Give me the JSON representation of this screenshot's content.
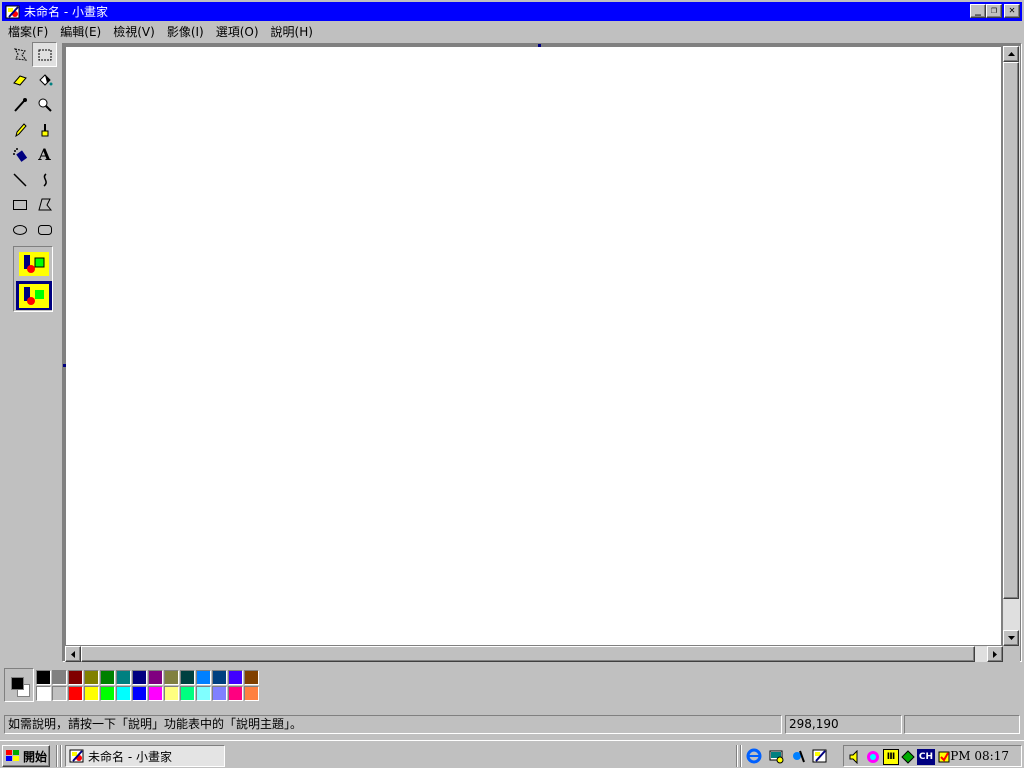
{
  "window": {
    "title": "未命名 - 小畫家",
    "minimize_glyph": "_",
    "restore_glyph": "❐",
    "close_glyph": "✕"
  },
  "menu": {
    "items": [
      {
        "label": "檔案(F)"
      },
      {
        "label": "編輯(E)"
      },
      {
        "label": "檢視(V)"
      },
      {
        "label": "影像(I)"
      },
      {
        "label": "選項(O)"
      },
      {
        "label": "說明(H)"
      }
    ]
  },
  "toolbox": {
    "tools": [
      {
        "icon": "free-form-select-icon"
      },
      {
        "icon": "rect-select-icon",
        "pressed": true
      },
      {
        "icon": "eraser-icon"
      },
      {
        "icon": "fill-bucket-icon"
      },
      {
        "icon": "color-picker-icon"
      },
      {
        "icon": "magnifier-icon"
      },
      {
        "icon": "pencil-icon"
      },
      {
        "icon": "brush-icon"
      },
      {
        "icon": "airbrush-icon"
      },
      {
        "icon": "text-icon",
        "glyph": "A"
      },
      {
        "icon": "line-icon"
      },
      {
        "icon": "curve-icon"
      },
      {
        "icon": "rectangle-icon"
      },
      {
        "icon": "polygon-icon"
      },
      {
        "icon": "ellipse-icon"
      },
      {
        "icon": "rounded-rect-icon"
      }
    ],
    "options": [
      {
        "icon": "opaque-background-icon",
        "selected": false
      },
      {
        "icon": "transparent-background-icon",
        "selected": true
      }
    ]
  },
  "palette": {
    "foreground": "#000000",
    "background": "#ffffff",
    "row1": [
      "#000000",
      "#808080",
      "#800000",
      "#808000",
      "#008000",
      "#008080",
      "#000080",
      "#800080",
      "#808040",
      "#004040",
      "#0080ff",
      "#004080",
      "#4000ff",
      "#804000"
    ],
    "row2": [
      "#ffffff",
      "#c0c0c0",
      "#ff0000",
      "#ffff00",
      "#00ff00",
      "#00ffff",
      "#0000ff",
      "#ff00ff",
      "#ffff80",
      "#00ff80",
      "#80ffff",
      "#8080ff",
      "#ff0080",
      "#ff8040"
    ]
  },
  "status": {
    "help_text": "如需說明，請按一下「說明」功能表中的「說明主題」。",
    "coordinates": "298,190",
    "size": ""
  },
  "taskbar": {
    "start_label": "開始",
    "task_label": "未命名 - 小畫家",
    "quicklaunch": [
      "ie-icon",
      "desktop-icon",
      "channels-icon",
      "paint-icon"
    ],
    "tray": [
      "speaker-icon",
      "color-wheel-icon",
      "ime-icon",
      "network-icon",
      "ch-input-icon",
      "scheduler-icon"
    ],
    "ime_label": "Ⅲ",
    "ch_label": "CH",
    "clock": "PM 08:17"
  }
}
